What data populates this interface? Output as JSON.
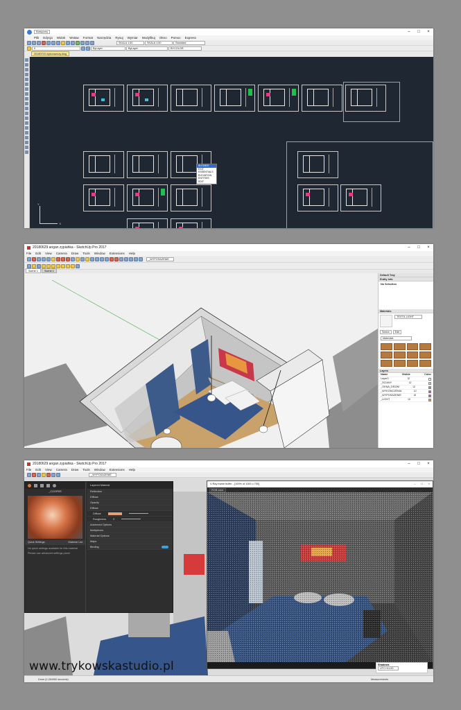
{
  "cad": {
    "title": "",
    "menu": [
      "Plik",
      "Edycja",
      "Widok",
      "Wstaw",
      "Format",
      "Narzędzia",
      "Rysuj",
      "Wymiar",
      "Modyfikuj",
      "Okno",
      "Pomoc",
      "Express"
    ],
    "file_tab": "20180703 wykonawczy.dwg",
    "workspace": "Klasyczny",
    "layer": "0",
    "scale1": "SKALA 1:50",
    "scale2": "SKALA 1:50",
    "style": "Standard",
    "bylayer1": "ByLayer",
    "bylayer2": "ByLayer",
    "bycolor": "BYCOLOR",
    "context_menu": [
      "ALIGNED",
      "EXIT",
      "ESSENTIALS",
      "ELEVATION",
      "ENTITIES",
      "EDIT"
    ],
    "ucs_x": "X",
    "ucs_y": "Y"
  },
  "sketchup": {
    "title": "20180629 angan zypiahka - SketchUp Pro 2017",
    "menu": [
      "File",
      "Edit",
      "View",
      "Camera",
      "Draw",
      "Tools",
      "Window",
      "Extensions",
      "Help"
    ],
    "layer_dropdown": "_WYPOSAZENIE",
    "scene_tabs": [
      "Scene 1",
      "Scene 1"
    ],
    "tray": {
      "default_tray": "Default Tray",
      "entity_info": "Entity Info",
      "no_selection": "No Selection",
      "materials": "Materials",
      "material_name": "TEXTIL LIGHT",
      "select_tab": "Select",
      "edit_tab": "Edit",
      "library": "Materials",
      "layers": "Layers",
      "layer_columns": [
        "Name",
        "Visible",
        "Color"
      ],
      "layer_names": [
        "Layer0",
        "_SCIANY",
        "_OKNA_DRZWI",
        "_WYKONCZENIA",
        "_WYPOSAZENIE",
        "_LIGHT"
      ],
      "layer_colors": [
        "#ffffff",
        "#d0d0d0",
        "#9a9a9a",
        "#d040c0",
        "#d040c0",
        "#e0a030"
      ]
    }
  },
  "vray": {
    "title": "20180629 angan zypiahka - SketchUp Pro 2017",
    "menu": [
      "File",
      "Edit",
      "View",
      "Camera",
      "Draw",
      "Tools",
      "Window",
      "Extensions",
      "Help"
    ],
    "layer_dropdown": "_WYPOSAZENIE",
    "asset_editor": "V-Ray Asset Editor",
    "material_name": "_COOPER",
    "quick_settings": "Quick Settings",
    "material_list": "Material List",
    "no_quick": "No quick settings available for this material",
    "advanced_note": "Please use advanced settings panel",
    "layered_material": "Layered Material",
    "props": [
      "Reflection",
      "Diffuse",
      "Opacity",
      "Diffuse",
      "Advanced Options",
      "Multiplexes",
      "Material Options",
      "Maps",
      "Binding"
    ],
    "diffuse_label": "Diffuse",
    "roughness_label": "Roughness",
    "roughness_val": "0",
    "frame_buffer_title": "V-Ray frame buffer - [100% of 1000 x 750]",
    "rgb_label": "RGB color",
    "status": "Done (2,264060 seconds)",
    "measurements": "Measurements",
    "shadows": "Shadows",
    "utc": "UTC+01:00"
  },
  "watermark": "www.trykowskastudio.pl"
}
